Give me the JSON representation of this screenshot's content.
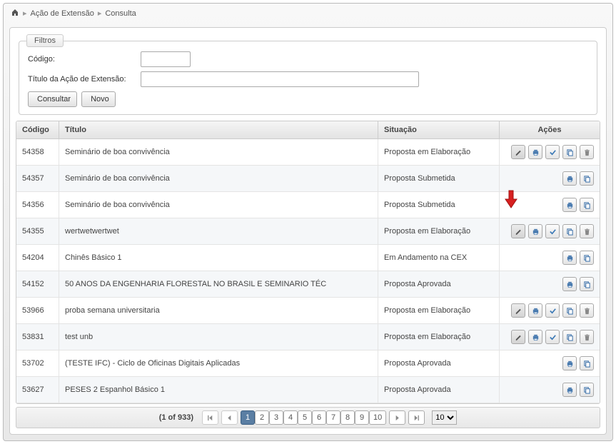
{
  "breadcrumb": {
    "item1": "Ação de Extensão",
    "item2": "Consulta"
  },
  "filters": {
    "legend": "Filtros",
    "codigo_label": "Código:",
    "codigo_value": "",
    "titulo_label": "Título da Ação de Extensão:",
    "titulo_value": "",
    "consultar_label": "Consultar",
    "novo_label": "Novo"
  },
  "grid": {
    "headers": {
      "codigo": "Código",
      "titulo": "Título",
      "situacao": "Situação",
      "acoes": "Ações"
    },
    "rows": [
      {
        "codigo": "54358",
        "titulo": "Seminário de boa convivência",
        "situacao": "Proposta em Elaboração",
        "actions": "full",
        "arrow": false
      },
      {
        "codigo": "54357",
        "titulo": "Seminário de boa convivência",
        "situacao": "Proposta Submetida",
        "actions": "two",
        "arrow": false
      },
      {
        "codigo": "54356",
        "titulo": "Seminário de boa convivência",
        "situacao": "Proposta Submetida",
        "actions": "two",
        "arrow": true
      },
      {
        "codigo": "54355",
        "titulo": "wertwetwertwet",
        "situacao": "Proposta em Elaboração",
        "actions": "full",
        "arrow": false
      },
      {
        "codigo": "54204",
        "titulo": "Chinês Básico 1",
        "situacao": "Em Andamento na CEX",
        "actions": "two",
        "arrow": false
      },
      {
        "codigo": "54152",
        "titulo": "50 ANOS DA ENGENHARIA FLORESTAL NO BRASIL E SEMINARIO TÉC",
        "situacao": "Proposta Aprovada",
        "actions": "two",
        "arrow": false
      },
      {
        "codigo": "53966",
        "titulo": "proba semana universitaria",
        "situacao": "Proposta em Elaboração",
        "actions": "full",
        "arrow": false
      },
      {
        "codigo": "53831",
        "titulo": "test unb",
        "situacao": "Proposta em Elaboração",
        "actions": "full",
        "arrow": false
      },
      {
        "codigo": "53702",
        "titulo": "(TESTE IFC) - Ciclo de Oficinas Digitais Aplicadas",
        "situacao": "Proposta Aprovada",
        "actions": "two",
        "arrow": false
      },
      {
        "codigo": "53627",
        "titulo": "PESES 2 Espanhol Básico 1",
        "situacao": "Proposta Aprovada",
        "actions": "two",
        "arrow": false
      }
    ]
  },
  "paginator": {
    "page_info": "(1 of 933)",
    "pages": [
      "1",
      "2",
      "3",
      "4",
      "5",
      "6",
      "7",
      "8",
      "9",
      "10"
    ],
    "active_page": "1",
    "rows_per_page": "10"
  },
  "icon_names": {
    "home": "home-icon",
    "search": "search-icon",
    "plus": "plus-icon",
    "pencil": "pencil-icon",
    "print": "print-icon",
    "check": "check-icon",
    "copy": "copy-icon",
    "trash": "trash-icon",
    "first": "first-icon",
    "prev": "prev-icon",
    "next": "next-icon",
    "last": "last-icon"
  }
}
